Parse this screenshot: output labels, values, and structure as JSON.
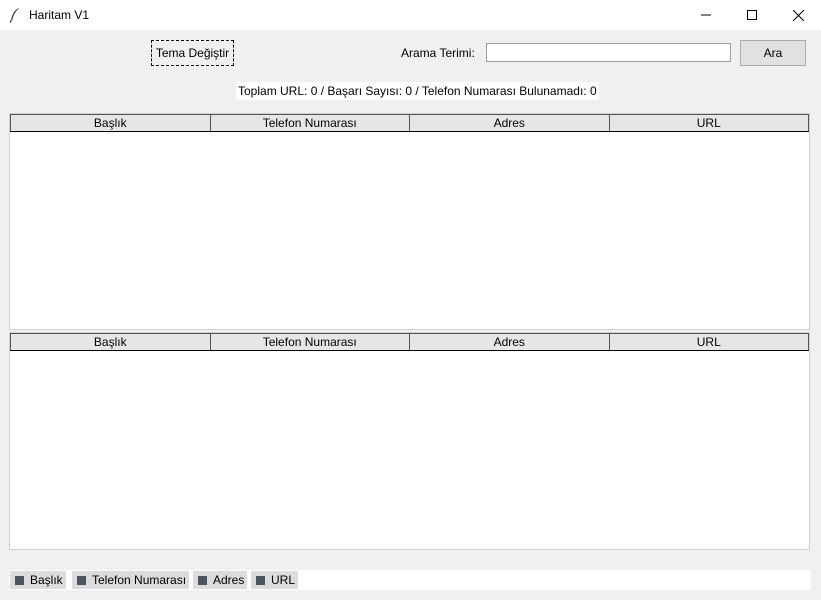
{
  "window": {
    "title": "Haritam V1"
  },
  "toolbar": {
    "theme_button": "Tema Değiştir",
    "search_label": "Arama Terimi:",
    "search_value": "",
    "search_button": "Ara"
  },
  "status": {
    "text": "Toplam URL: 0 / Başarı Sayısı: 0 / Telefon Numarası Bulunamadı: 0"
  },
  "table1": {
    "columns": [
      "Başlık",
      "Telefon Numarası",
      "Adres",
      "URL"
    ],
    "rows": []
  },
  "table2": {
    "columns": [
      "Başlık",
      "Telefon Numarası",
      "Adres",
      "URL"
    ],
    "rows": []
  },
  "column_toggles": [
    {
      "label": "Başlık",
      "checked": true
    },
    {
      "label": "Telefon Numarası",
      "checked": true
    },
    {
      "label": "Adres",
      "checked": true
    },
    {
      "label": "URL",
      "checked": true
    }
  ],
  "icons": {
    "app": "feather-icon",
    "minimize": "minimize-icon",
    "maximize": "maximize-icon",
    "close": "close-icon"
  }
}
